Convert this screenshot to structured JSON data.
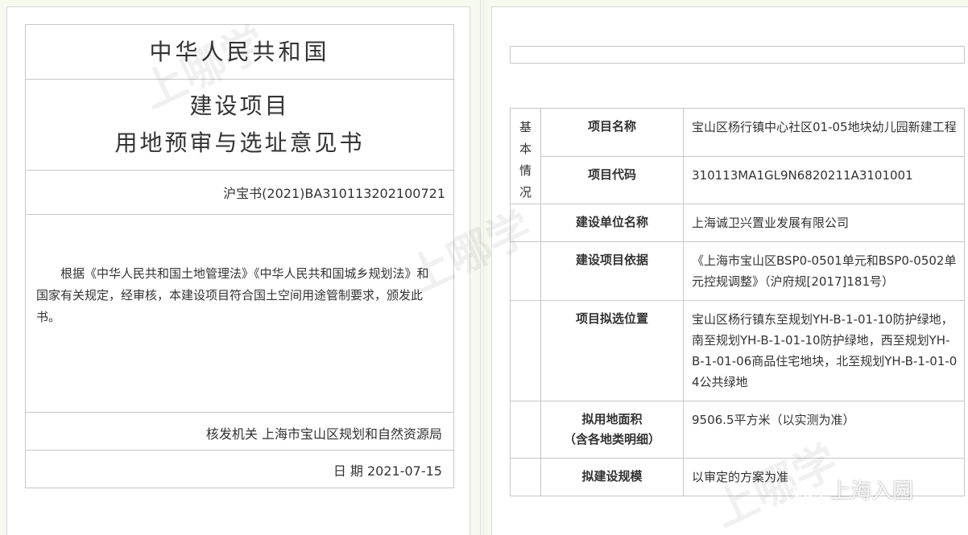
{
  "left_page": {
    "country": "中华人民共和国",
    "title_line1": "建设项目",
    "title_line2": "用地预审与选址意见书",
    "cert_no": "沪宝书(2021)BA310113202100721",
    "body": "根据《中华人民共和国土地管理法》《中华人民共和国城乡规划法》和国家有关规定，经审核，本建设项目符合国土空间用途管制要求，颁发此书。",
    "issuer": "核发机关 上海市宝山区规划和自然资源局",
    "date": "日  期 2021-07-15"
  },
  "right_page": {
    "section_label": "基本情况",
    "rows": [
      {
        "label": "项目名称",
        "value": "宝山区杨行镇中心社区01-05地块幼儿园新建工程"
      },
      {
        "label": "项目代码",
        "value": "310113MA1GL9N6820211A3101001"
      },
      {
        "label": "建设单位名称",
        "value": "上海诚卫兴置业发展有限公司"
      },
      {
        "label": "建设项目依据",
        "value": "《上海市宝山区BSP0-0501单元和BSP0-0502单元控规调整》（沪府规[2017]181号）"
      },
      {
        "label": "项目拟选位置",
        "value": "宝山区杨行镇东至规划YH-B-1-01-10防护绿地，南至规划YH-B-1-01-10防护绿地，西至规划YH-B-1-01-06商品住宅地块，北至规划YH-B-1-01-04公共绿地"
      },
      {
        "label": "拟用地面积\n（含各地类明细）",
        "value": "9506.5平方米（以实测为准）"
      },
      {
        "label": "拟建设规模",
        "value": "以审定的方案为准"
      }
    ]
  },
  "watermark": {
    "brand": "上哪学",
    "logo_text": "上海入园"
  }
}
